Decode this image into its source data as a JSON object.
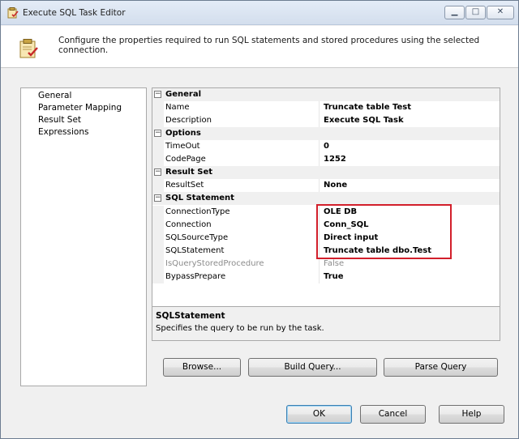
{
  "window": {
    "title": "Execute SQL Task Editor",
    "header_text": "Configure the properties required to run SQL statements and stored procedures using the selected connection."
  },
  "nav": {
    "items": [
      {
        "label": "General",
        "selected": true
      },
      {
        "label": "Parameter Mapping"
      },
      {
        "label": "Result Set"
      },
      {
        "label": "Expressions"
      }
    ]
  },
  "grid": {
    "categories": [
      {
        "label": "General",
        "expander": "⊟",
        "properties": [
          {
            "name": "Name",
            "value": "Truncate table Test"
          },
          {
            "name": "Description",
            "value": "Execute SQL Task"
          }
        ]
      },
      {
        "label": "Options",
        "expander": "⊟",
        "properties": [
          {
            "name": "TimeOut",
            "value": "0"
          },
          {
            "name": "CodePage",
            "value": "1252"
          }
        ]
      },
      {
        "label": "Result Set",
        "expander": "⊟",
        "properties": [
          {
            "name": "ResultSet",
            "value": "None"
          }
        ]
      },
      {
        "label": "SQL Statement",
        "expander": "⊟",
        "properties": [
          {
            "name": "ConnectionType",
            "value": "OLE DB"
          },
          {
            "name": "Connection",
            "value": "Conn_SQL"
          },
          {
            "name": "SQLSourceType",
            "value": "Direct input"
          },
          {
            "name": "SQLStatement",
            "value": "Truncate table dbo.Test"
          },
          {
            "name": "IsQueryStoredProcedure",
            "value": "False",
            "disabled": true
          },
          {
            "name": "BypassPrepare",
            "value": "True"
          }
        ]
      }
    ]
  },
  "description": {
    "title": "SQLStatement",
    "text": "Specifies the query to be run by the task."
  },
  "buttons": {
    "browse": "Browse...",
    "build_query": "Build Query...",
    "parse_query": "Parse Query",
    "ok": "OK",
    "cancel": "Cancel",
    "help": "Help"
  },
  "colors": {
    "highlight_box": "#d21f2b",
    "category_band": "#f0f0f0"
  }
}
